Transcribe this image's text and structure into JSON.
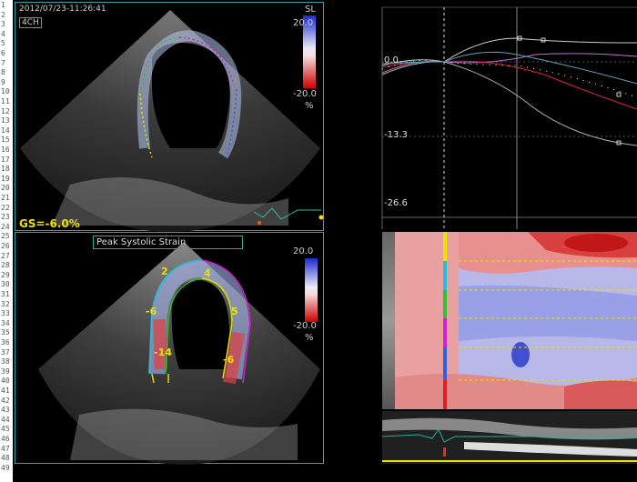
{
  "row_numbers": [
    "1",
    "2",
    "3",
    "4",
    "5",
    "6",
    "7",
    "8",
    "9",
    "10",
    "11",
    "12",
    "13",
    "14",
    "15",
    "16",
    "17",
    "18",
    "19",
    "20",
    "21",
    "22",
    "23",
    "24",
    "25",
    "26",
    "27",
    "28",
    "29",
    "30",
    "31",
    "32",
    "33",
    "34",
    "35",
    "36",
    "37",
    "38",
    "39",
    "40",
    "41",
    "42",
    "43",
    "44",
    "45",
    "46",
    "47",
    "48",
    "49"
  ],
  "top_left": {
    "timestamp": "2012/07/23-11:26:41",
    "view": "4CH",
    "scale_label": "SL",
    "scale_max": "20.0",
    "scale_min": "-20.0",
    "scale_unit": "%",
    "global_strain": "GS=-6.0%"
  },
  "bottom_left": {
    "title": "Peak Systolic Strain",
    "scale_max": "20.0",
    "scale_min": "-20.0",
    "scale_unit": "%",
    "segment_values": [
      "2",
      "4",
      "-6",
      "5",
      "-14",
      "-6"
    ]
  },
  "top_right": {
    "y_labels": [
      "0.0",
      "-13.3",
      "-26.6"
    ]
  },
  "colors": {
    "panel_border": "#2aa6a6",
    "strain_text": "#f0e000",
    "scale_positive": "#2233cc",
    "scale_negative": "#dd1111"
  }
}
